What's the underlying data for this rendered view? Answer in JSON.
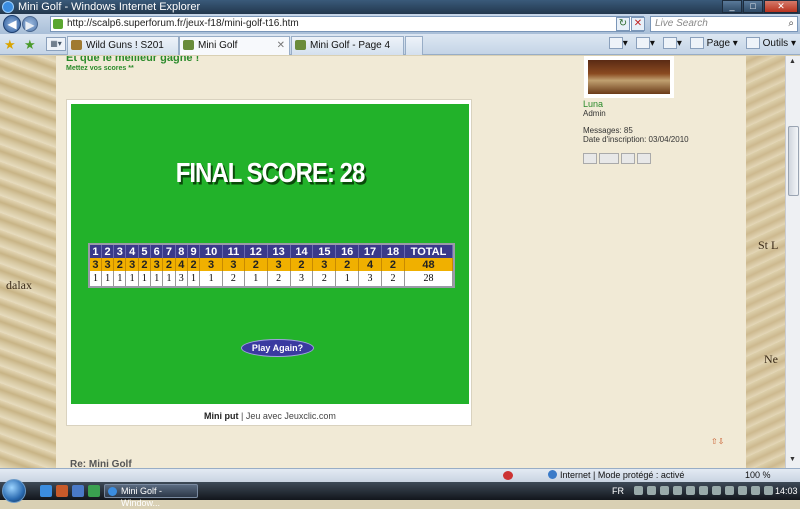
{
  "window": {
    "title": "Mini Golf - Windows Internet Explorer"
  },
  "address_bar": {
    "url": "http://scalp6.superforum.fr/jeux-f18/mini-golf-t16.htm",
    "search_placeholder": "Live Search"
  },
  "tabs": [
    {
      "label": "Wild Guns ! S201",
      "active": false
    },
    {
      "label": "Mini Golf",
      "active": true
    },
    {
      "label": "Mini Golf - Page 4",
      "active": false
    }
  ],
  "command_bar": {
    "page_label": "Page",
    "tools_label": "Outils"
  },
  "post": {
    "title": "Et que le meilleur gagne !",
    "subtitle": "Mettez vos scores **"
  },
  "game": {
    "final_score_label": "FINAL SCORE: 28",
    "holes": [
      "1",
      "2",
      "3",
      "4",
      "5",
      "6",
      "7",
      "8",
      "9",
      "10",
      "11",
      "12",
      "13",
      "14",
      "15",
      "16",
      "17",
      "18"
    ],
    "total_label": "TOTAL",
    "par": [
      "3",
      "3",
      "2",
      "3",
      "2",
      "3",
      "2",
      "4",
      "2",
      "3",
      "3",
      "2",
      "3",
      "2",
      "3",
      "2",
      "4",
      "2"
    ],
    "par_total": "48",
    "strokes": [
      "1",
      "1",
      "1",
      "1",
      "1",
      "1",
      "1",
      "3",
      "1",
      "1",
      "2",
      "1",
      "2",
      "3",
      "2",
      "1",
      "3",
      "2"
    ],
    "strokes_total": "28",
    "play_again_label": "Play Again?"
  },
  "credit": {
    "game_name": "Mini put",
    "separator": " | ",
    "rest": "Jeu avec Jeuxclic.com"
  },
  "profile": {
    "username": "Luna",
    "role": "Admin",
    "messages": "Messages: 85",
    "join_date": "Date d'inscription: 03/04/2010"
  },
  "map_labels": {
    "left": "dalax",
    "right_top": "St L",
    "right_bottom": "Ne"
  },
  "reply": {
    "title": "Re: Mini Golf"
  },
  "status_bar": {
    "zone": "Internet | Mode protégé : activé",
    "zoom": "100 %"
  },
  "taskbar": {
    "window_button": "Mini Golf - Window...",
    "lang": "FR",
    "clock": "14:03"
  }
}
